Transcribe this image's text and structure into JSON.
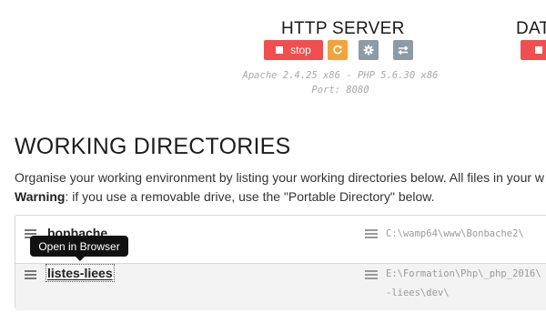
{
  "servers": {
    "http": {
      "title": "HTTP SERVER",
      "stop_label": "stop",
      "version": "Apache 2.4.25 x86 - PHP 5.6.30 x86",
      "port": "Port: 8080"
    },
    "database": {
      "title_partial": "DAT"
    }
  },
  "working": {
    "title": "WORKING DIRECTORIES",
    "description": "Organise your working environment by listing your working directories below. All files in your w",
    "warning_label": "Warning",
    "warning_text": ": if you use a removable drive, use the \"Portable Directory\" below.",
    "directories": [
      {
        "name": "bonbache",
        "path": "C:\\wamp64\\www\\Bonbache2\\"
      },
      {
        "name": "listes-liees",
        "path_line1": "E:\\Formation\\Php\\_php_2016\\",
        "path_line2": "-liees\\dev\\"
      }
    ],
    "tooltip": "Open in Browser"
  },
  "colors": {
    "stop": "#ef4f4f",
    "restart": "#f2a33a",
    "neutral": "#8e9aa4"
  }
}
